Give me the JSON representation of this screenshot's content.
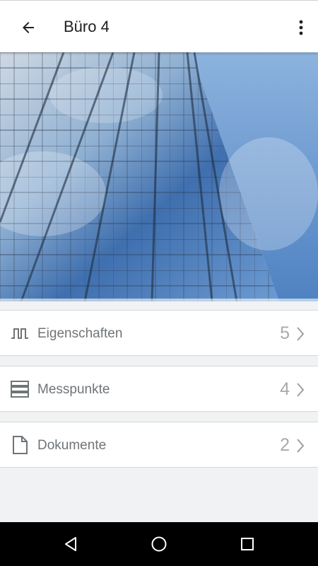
{
  "app_bar": {
    "title": "Büro 4",
    "back_icon": "arrow-left-icon",
    "more_icon": "more-vertical-icon"
  },
  "hero": {
    "image": "glass-skyscraper-photo"
  },
  "list": [
    {
      "label": "Eigenschaften",
      "count": "5",
      "icon": "square-wave-icon"
    },
    {
      "label": "Messpunkte",
      "count": "4",
      "icon": "stacked-rows-icon"
    },
    {
      "label": "Dokumente",
      "count": "2",
      "icon": "document-icon"
    }
  ],
  "nav_bar": {
    "back_icon": "triangle-back-icon",
    "home_icon": "circle-home-icon",
    "recents_icon": "square-recents-icon"
  },
  "colors": {
    "app_bar_bg": "#ffffff",
    "page_bg": "#f0f2f3",
    "label_text": "#6f7478",
    "count_text": "#a7abae",
    "nav_bg": "#000000"
  }
}
